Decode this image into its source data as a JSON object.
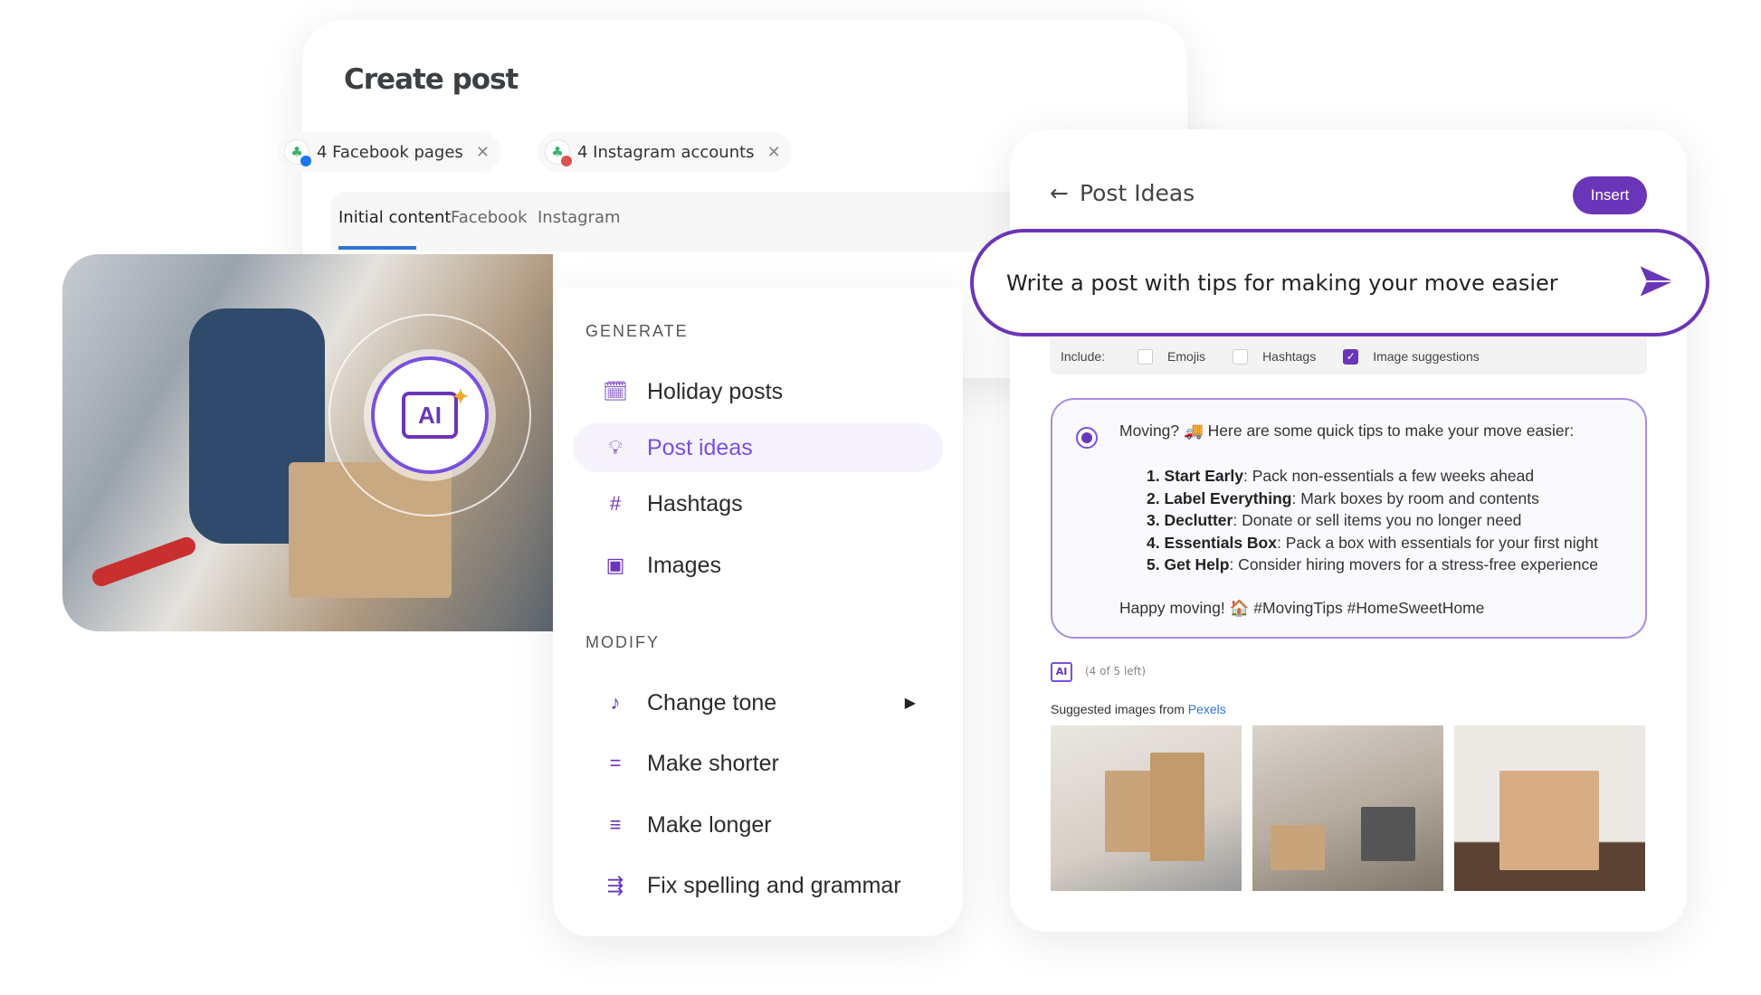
{
  "create_post": {
    "title": "Create post",
    "chips": [
      {
        "label": "4 Facebook pages",
        "network_color": "#1877f2"
      },
      {
        "label": "4 Instagram accounts",
        "network_color": "#d9534f"
      }
    ],
    "tabs": [
      "Initial content",
      "Facebook",
      "Instagram"
    ],
    "active_tab": "Initial content",
    "toolbar_icons": [
      "camera-icon",
      "emoji-icon",
      "ai-icon"
    ],
    "ai_label": "AI"
  },
  "menu": {
    "generate_label": "GENERATE",
    "generate_items": [
      {
        "label": "Holiday posts",
        "icon": "calendar-bolt-icon"
      },
      {
        "label": "Post ideas",
        "icon": "lightbulb-icon",
        "active": true
      },
      {
        "label": "Hashtags",
        "icon": "hash-icon"
      },
      {
        "label": "Images",
        "icon": "image-icon"
      }
    ],
    "modify_label": "MODIFY",
    "modify_items": [
      {
        "label": "Change tone",
        "icon": "tone-icon",
        "submenu": true
      },
      {
        "label": "Make shorter",
        "icon": "short-text-icon"
      },
      {
        "label": "Make longer",
        "icon": "long-text-icon"
      },
      {
        "label": "Fix spelling and grammar",
        "icon": "spell-check-icon"
      }
    ]
  },
  "ideas": {
    "title": "Post Ideas",
    "insert_label": "Insert",
    "prompt": "Write a post with tips for making your move easier",
    "include_label": "Include:",
    "options": [
      {
        "label": "Emojis",
        "checked": false
      },
      {
        "label": "Hashtags",
        "checked": false
      },
      {
        "label": "Image suggestions",
        "checked": true
      }
    ],
    "response": {
      "intro": "Moving? 🚚 Here are some quick tips to make your move easier:",
      "tips": [
        {
          "n": "1.",
          "title": "Start Early",
          "text": ": Pack non-essentials a few weeks ahead"
        },
        {
          "n": "2.",
          "title": "Label Everything",
          "text": ": Mark boxes by room and contents"
        },
        {
          "n": "3.",
          "title": "Declutter",
          "text": ": Donate or sell items you no longer need"
        },
        {
          "n": "4.",
          "title": "Essentials Box",
          "text": ": Pack a box with essentials for your first night"
        },
        {
          "n": "5.",
          "title": "Get Help",
          "text": ": Consider hiring movers for a stress-free experience"
        }
      ],
      "outro": "Happy moving! 🏠 #MovingTips #HomeSweetHome"
    },
    "ai_badge": "AI",
    "remaining": "(4 of 5 left)",
    "suggested_label": "Suggested images from ",
    "suggested_source": "Pexels"
  },
  "colors": {
    "accent": "#6a35b8",
    "tab_underline": "#2f74d8",
    "link": "#2f74d8"
  }
}
